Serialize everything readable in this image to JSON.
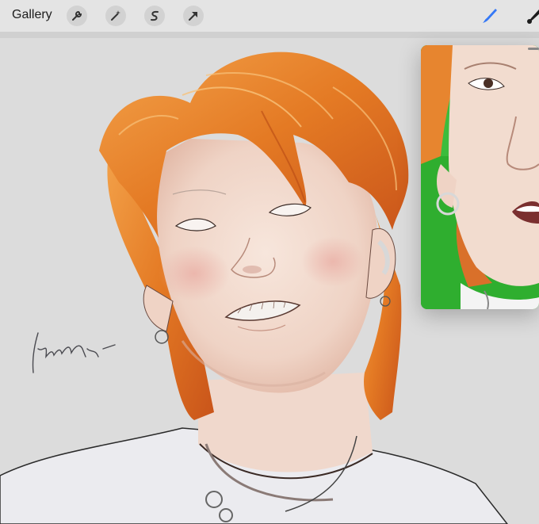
{
  "toolbar": {
    "gallery_label": "Gallery",
    "left_tools": [
      {
        "icon": "wrench-icon",
        "name": "actions"
      },
      {
        "icon": "magic-wand-icon",
        "name": "adjustments"
      },
      {
        "icon": "selection-s-icon",
        "name": "selection"
      },
      {
        "icon": "arrow-cursor-icon",
        "name": "transform"
      }
    ],
    "right_tools": [
      {
        "icon": "brush-icon",
        "name": "brush",
        "active": true,
        "color": "#3478f6"
      },
      {
        "icon": "smudge-icon",
        "name": "smudge",
        "active": false
      }
    ]
  },
  "canvas": {
    "signature_visible": true
  },
  "reference_window": {
    "visible": true
  },
  "colors": {
    "accent": "#3478f6",
    "hair": "#e8822a",
    "skin": "#f2dcd0",
    "ref_green": "#2fae2f"
  }
}
